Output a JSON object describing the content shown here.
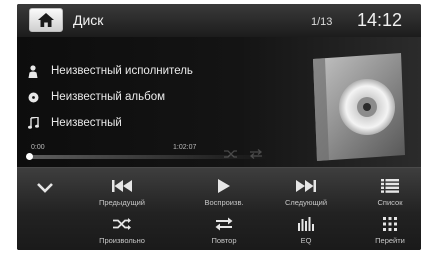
{
  "header": {
    "title": "Диск",
    "track_counter": "1/13",
    "clock": "14:12"
  },
  "track": {
    "artist": "Неизвестный исполнитель",
    "album": "Неизвестный альбом",
    "song": "Неизвестный",
    "time_elapsed": "0:00",
    "time_total": "1:02:07",
    "progress": 0.0
  },
  "controls": {
    "prev_label": "Предыдущий",
    "play_label": "Воспроизв.",
    "next_label": "Следующий",
    "list_label": "Список",
    "shuffle_label": "Произвольно",
    "repeat_label": "Повтор",
    "eq_label": "EQ",
    "goto_label": "Перейти"
  },
  "icons": {
    "home": "home-icon",
    "artist": "person-icon",
    "album": "disc-icon",
    "song": "music-note-icon",
    "collapse": "chevron-down-icon",
    "prev": "skip-previous-icon",
    "play": "play-icon",
    "next": "skip-next-icon",
    "list": "list-icon",
    "shuffle": "shuffle-icon",
    "repeat": "repeat-icon",
    "eq": "equalizer-icon",
    "goto": "grid-icon"
  },
  "colors": {
    "background": "#101010",
    "text": "#eaeaea",
    "label": "#c8c8c8"
  }
}
